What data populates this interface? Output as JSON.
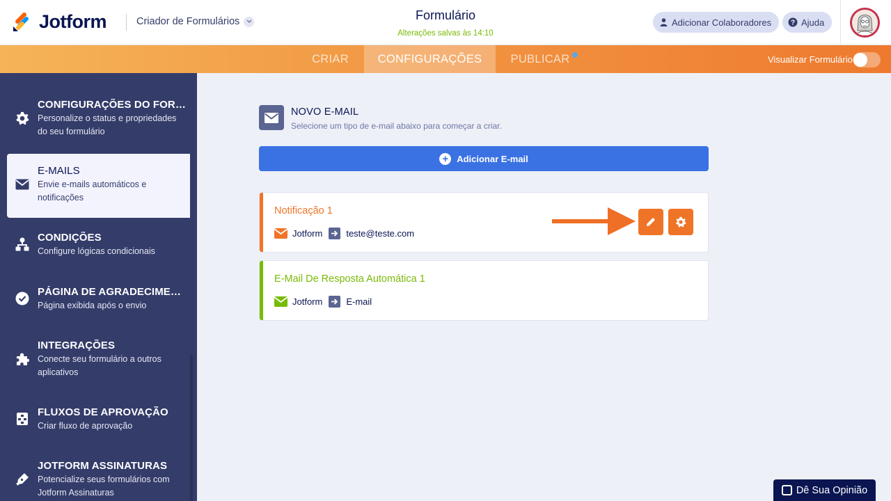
{
  "header": {
    "brand": "Jotform",
    "builder_dropdown": "Criador de Formulários",
    "form_title": "Formulário",
    "save_status": "Alterações salvas às 14:10",
    "add_collaborators": "Adicionar Colaboradores",
    "help": "Ajuda"
  },
  "tabs": [
    {
      "label": "CRIAR",
      "active": false
    },
    {
      "label": "CONFIGURAÇÕES",
      "active": true
    },
    {
      "label": "PUBLICAR",
      "active": false
    }
  ],
  "preview": {
    "label": "Visualizar Formulário",
    "enabled": false
  },
  "sidebar": {
    "items": [
      {
        "title": "CONFIGURAÇÕES DO FORM...",
        "desc": "Personalize o status e propriedades do seu formulário",
        "icon": "gear-icon"
      },
      {
        "title": "E-MAILS",
        "desc": "Envie e-mails automáticos e notificações",
        "icon": "envelope-icon",
        "active": true
      },
      {
        "title": "CONDIÇÕES",
        "desc": "Configure lógicas condicionais",
        "icon": "hierarchy-icon"
      },
      {
        "title": "PÁGINA DE AGRADECIMENTO",
        "desc": "Página exibida após o envio",
        "icon": "check-circle-icon"
      },
      {
        "title": "INTEGRAÇÕES",
        "desc": "Conecte seu formulário a outros aplicativos",
        "icon": "puzzle-icon"
      },
      {
        "title": "FLUXOS DE APROVAÇÃO",
        "desc": "Criar fluxo de aprovação",
        "icon": "approval-flow-icon"
      },
      {
        "title": "JOTFORM ASSINATURAS",
        "desc": "Potencialize seus formulários com Jotform Assinaturas",
        "icon": "pen-icon"
      }
    ]
  },
  "main": {
    "new_email_title": "NOVO E-MAIL",
    "new_email_desc": "Selecione um tipo de e-mail abaixo para começar a criar.",
    "add_email_button": "Adicionar E-mail",
    "emails": [
      {
        "title": "Notificação 1",
        "from": "Jotform",
        "to": "teste@teste.com",
        "color": "#f07428"
      },
      {
        "title": "E-Mail De Resposta Automática 1",
        "from": "Jotform",
        "to": "E-mail",
        "color": "#78bb07"
      }
    ]
  },
  "feedback": {
    "label": "Dê Sua Opinião"
  },
  "colors": {
    "accent_orange": "#f07428",
    "accent_green": "#78bb07",
    "primary_blue": "#3a72e3",
    "navy": "#0a1551",
    "sidebar_bg": "#343c6a"
  }
}
